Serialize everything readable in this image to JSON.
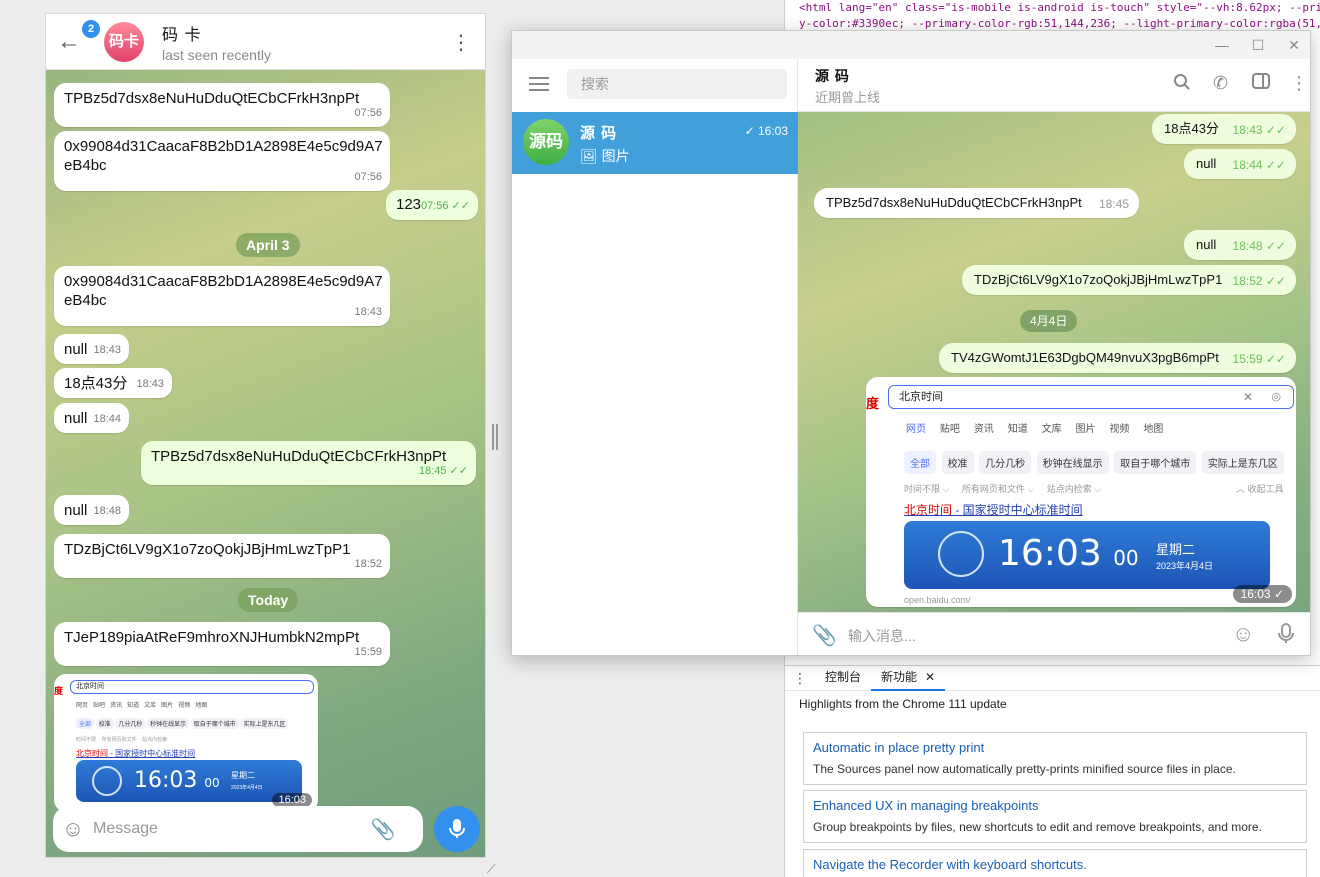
{
  "devtools": {
    "code_lines": [
      "<html lang=\"en\" class=\"is-mobile is-android is-touch\" style=\"--vh:8.62px; --pri",
      "y-color:#3390ec; --primary-color-rgb:51,144,236; --light-primary-color:rgba(51,"
    ],
    "tabs": {
      "console": "控制台",
      "whats_new": "新功能",
      "close": "✕"
    },
    "highlights_title": "Highlights from the Chrome 111 update",
    "cards": [
      {
        "title": "Automatic in place pretty print",
        "desc": "The Sources panel now automatically pretty-prints minified source files in place."
      },
      {
        "title": "Enhanced UX in managing breakpoints",
        "desc": "Group breakpoints by files, new shortcuts to edit and remove breakpoints, and more."
      },
      {
        "title": "Navigate the Recorder with keyboard shortcuts.",
        "desc": ""
      }
    ]
  },
  "mobile": {
    "badge": "2",
    "avatar_text": "码卡",
    "contact_name": "码 卡",
    "status": "last seen recently",
    "messages": [
      {
        "text": "TPBz5d7dsx8eNuHuDduQtECbCFrkH3npPt",
        "time": "07:56"
      },
      {
        "text": "0x99084d31CaacaF8B2bD1A2898E4e5c9d9A7eB4bc",
        "time": "07:56"
      },
      {
        "text": "123",
        "time": "07:56"
      },
      {
        "text": "0x99084d31CaacaF8B2bD1A2898E4e5c9d9A7eB4bc",
        "time": "18:43"
      },
      {
        "text": "null",
        "time": "18:43"
      },
      {
        "text": "18点43分",
        "time": "18:43"
      },
      {
        "text": "null",
        "time": "18:44"
      },
      {
        "text": "TPBz5d7dsx8eNuHuDduQtECbCFrkH3npPt",
        "time": "18:45"
      },
      {
        "text": "null",
        "time": "18:48"
      },
      {
        "text": "TDzBjCt6LV9gX1o7zoQokjJBjHmLwzTpP1",
        "time": "18:52"
      },
      {
        "text": "TJeP189piaAtReF9mhroXNJHumbkN2mpPt",
        "time": "15:59"
      }
    ],
    "dates": {
      "april3": "April 3",
      "today": "Today"
    },
    "image_time": "16:03",
    "composer_placeholder": "Message"
  },
  "desktop": {
    "search_placeholder": "搜索",
    "chat": {
      "avatar_text": "源码",
      "name": "源 码",
      "time": "16:03",
      "preview": "图片"
    },
    "header": {
      "name": "源 码",
      "status": "近期曾上线"
    },
    "messages": [
      {
        "text": "18点43分",
        "time": "18:43"
      },
      {
        "text": "null",
        "time": "18:44"
      },
      {
        "text": "TPBz5d7dsx8eNuHuDduQtECbCFrkH3npPt",
        "time": "18:45"
      },
      {
        "text": "null",
        "time": "18:48"
      },
      {
        "text": "TDzBjCt6LV9gX1o7zoQokjJBjHmLwzTpP1",
        "time": "18:52"
      },
      {
        "text": "TV4zGWomtJ1E63DgbQM49nvuX3pgB6mpPt",
        "time": "15:59"
      }
    ],
    "date_pill": "4月4日",
    "image_time": "16:03",
    "composer_placeholder": "输入消息..."
  },
  "baidu": {
    "logo": "度",
    "query": "北京时间",
    "nav": [
      "网页",
      "贴吧",
      "资讯",
      "知道",
      "文库",
      "图片",
      "视频",
      "地图"
    ],
    "chips": [
      "全部",
      "校准",
      "几分几秒",
      "秒钟在线显示",
      "取自于哪个城市",
      "实际上是东几区"
    ],
    "filters": [
      "时间不限",
      "所有网页和文件",
      "站点内检索",
      "收起工具"
    ],
    "result_red": "北京时间",
    "result_rest": " - 国家授时中心标准时间",
    "clock_time": "16:03",
    "clock_sec": "00",
    "weekday": "星期二",
    "date": "2023年4月4日",
    "url": "open.baidu.com/"
  },
  "colors": {
    "accent": "#3390ec",
    "sidebar_selected": "#419fd9",
    "outgoing_bubble": "#eeffde"
  }
}
